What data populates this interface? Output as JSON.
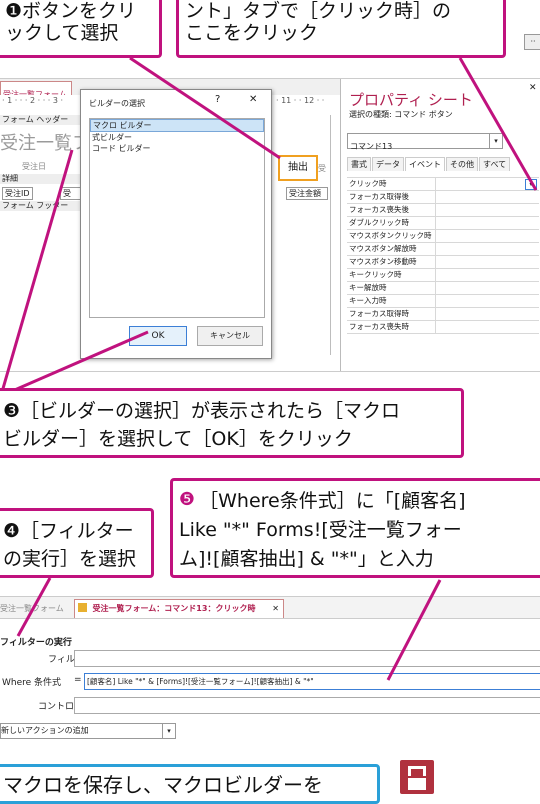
{
  "callouts": {
    "c1_line1": "❶ボタンをクリ",
    "c1_line2": "ックして選択",
    "c2_line1": "ント」タブで［クリック時］の",
    "c2_line2": "ここをクリック",
    "c3_line1": "❸［ビルダーの選択］が表示されたら［マクロ",
    "c3_line2": "ビルダー］を選択して［OK］をクリック",
    "c4_line1": "❹［フィルター",
    "c4_line2": "の実行］を選択",
    "c5_num": "❺",
    "c5_line1": "［Where条件式］に「[顧客名]",
    "c5_line2": "Like \"*\" Forms![受注一覧フォー",
    "c5_line3": "ム]![顧客抽出] & \"*\"」と入力",
    "c6": "マクロを保存し、マクロビルダーを"
  },
  "form_designer": {
    "tab_title": "受注一覧フォーム",
    "ruler": "· 1 · · · 2 · · · 3 ·",
    "form_header": "フォーム ヘッダー",
    "title_text": "受注一覧フ",
    "field_label_order_date": "受注日",
    "detail": "詳細",
    "field_order_id": "受注ID",
    "field_order_partial": "受",
    "form_footer": "フォーム フッター",
    "button_caption": "抽出",
    "right_label": "受注金額",
    "right_hdr": "受",
    "right_ruler": "· 11 · · 12 · ·"
  },
  "builder_dialog": {
    "title": "ビルダーの選択",
    "help": "?",
    "close": "✕",
    "options": [
      "マクロ ビルダー",
      "式ビルダー",
      "コード ビルダー"
    ],
    "selected_index": 0,
    "ok_label": "OK",
    "cancel_label": "キャンセル"
  },
  "property_sheet": {
    "title": "プロパティ シート",
    "subtitle": "選択の種類: コマンド ボタン",
    "object": "コマンド13",
    "tabs": [
      "書式",
      "データ",
      "イベント",
      "その他",
      "すべて"
    ],
    "active_tab": 2,
    "rows": [
      "クリック時",
      "フォーカス取得後",
      "フォーカス喪失後",
      "ダブルクリック時",
      "マウスボタンクリック時",
      "マウスボタン解放時",
      "マウスボタン移動時",
      "キークリック時",
      "キー解放時",
      "キー入力時",
      "フォーカス取得時",
      "フォーカス喪失時"
    ],
    "close_glyph": "✕"
  },
  "macro_editor": {
    "tab_inactive": "受注一覧フォーム",
    "tab_active": "受注一覧フォーム：コマンド13：クリック時",
    "close": "✕",
    "action_title": "フィルターの実行",
    "field_filter_label": "フィルター名",
    "field_where_label": "Where 条件式",
    "field_where_eq": "=",
    "field_where_value": "[顧客名] Like \"*\" & [Forms]![受注一覧フォーム]![顧客抽出] & \"*\"",
    "field_control_label": "コントロール名",
    "add_action": "新しいアクションの追加"
  }
}
